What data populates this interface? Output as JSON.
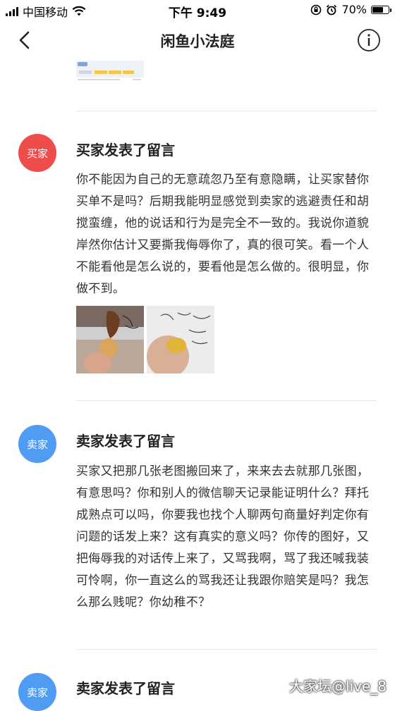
{
  "status_bar": {
    "carrier": "中国移动",
    "time": "下午 9:49",
    "battery": "70%",
    "battery_level": 0.7
  },
  "nav": {
    "title": "闲鱼小法庭",
    "back_icon": "chevron-left-icon",
    "info_icon": "info-circle-icon"
  },
  "messages": [
    {
      "avatar_label": "买家",
      "title": "买家发表了留言",
      "body": "你不能因为自己的无意疏忽乃至有意隐瞒，让买家替你买单不是吗？后期我能明显感觉到卖家的逃避责任和胡搅蛮缠，他的说话和行为是完全不一致的。我说你道貌岸然你估计又要撕我侮辱你了，真的很可笑。看一个人不能看他是怎么说的，要看他是怎么做的。很明显，你做不到。",
      "color": "#ef4c4c"
    },
    {
      "avatar_label": "卖家",
      "title": "卖家发表了留言",
      "body": "买家又把那几张老图搬回来了，来来去去就那几张图，有意思吗？你和别人的微信聊天记录能证明什么？拜托成熟点可以吗，你要我也找个人聊两句商量好判定你有问题的话发上来？这有真实的意义吗？你传的图好，又把侮辱我的对话传上来了，又骂我啊，骂了我还喊我装可怜啊，你一直这么的骂我还让我跟你赔笑是吗？我怎么那么贱呢？你幼稚不？",
      "color": "#4f9cf2"
    },
    {
      "avatar_label": "卖家",
      "title": "卖家发表了留言",
      "color": "#4f9cf2"
    }
  ],
  "watermark": "大家坛@live_8"
}
